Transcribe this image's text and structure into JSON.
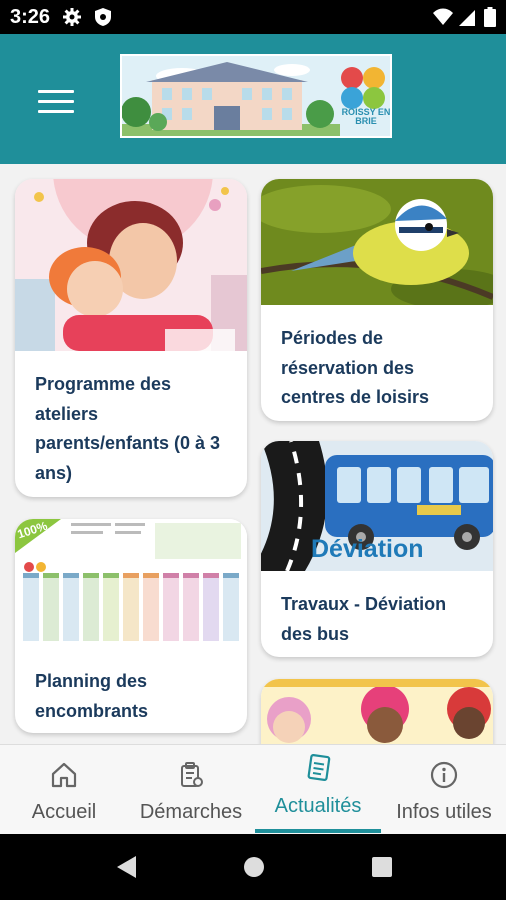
{
  "status_bar": {
    "time": "3:26",
    "icons": [
      "gear-icon",
      "shield-icon",
      "wifi-icon",
      "signal-icon",
      "battery-icon"
    ]
  },
  "header": {
    "menu_icon": "hamburger-menu-icon",
    "logo_text": "ROISSY EN BRIE",
    "background_color": "#1f8f9a"
  },
  "news": [
    {
      "title": "Programme des ateliers parents/enfants (0 à 3 ans)"
    },
    {
      "title": "Périodes de réservation des centres de loisirs"
    },
    {
      "title": "Travaux - Déviation des bus",
      "image_text": "Déviation"
    },
    {
      "title": "Planning des encombrants",
      "image_badge": "100%"
    },
    {
      "title": ""
    }
  ],
  "bottom_nav": {
    "items": [
      {
        "label": "Accueil",
        "icon": "home-icon"
      },
      {
        "label": "Démarches",
        "icon": "clipboard-icon"
      },
      {
        "label": "Actualités",
        "icon": "newspaper-icon",
        "active": true
      },
      {
        "label": "Infos utiles",
        "icon": "info-icon"
      }
    ],
    "active_color": "#1f8f9a"
  },
  "system_nav": [
    "back-icon",
    "home-circle-icon",
    "recents-icon"
  ]
}
